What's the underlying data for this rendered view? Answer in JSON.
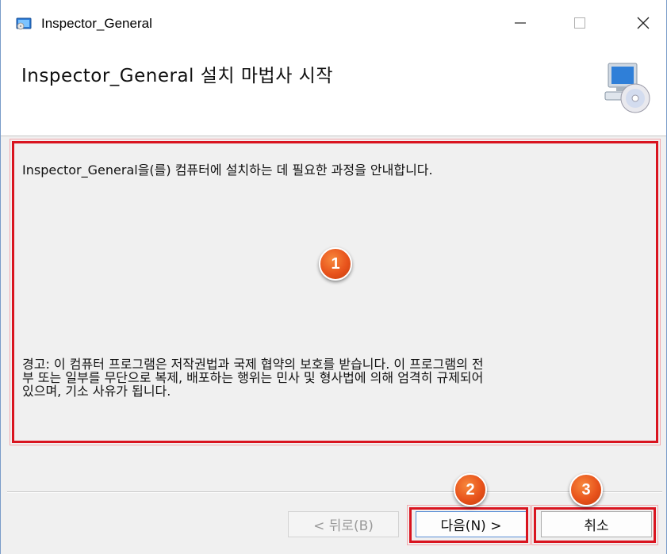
{
  "window": {
    "title": "Inspector_General",
    "app_icon": "installer-icon",
    "controls": {
      "minimize_icon": "minimize-icon",
      "maximize_icon": "maximize-icon",
      "close_icon": "close-icon"
    }
  },
  "header": {
    "title": "Inspector_General 설치 마법사 시작",
    "icon": "computer-cd-icon"
  },
  "content": {
    "intro": "Inspector_General을(를) 컴퓨터에 설치하는 데 필요한 과정을 안내합니다.",
    "warning_lines": [
      "경고: 이 컴퓨터 프로그램은 저작권법과 국제 협약의 보호를 받습니다. 이 프로그램의 전",
      "부 또는 일부를 무단으로 복제, 배포하는 행위는 민사 및 형사법에 의해 엄격히 규제되어",
      "있으며, 기소 사유가 됩니다."
    ]
  },
  "buttons": {
    "back": "< 뒤로(B)",
    "next": "다음(N) >",
    "cancel": "취소"
  },
  "annotations": {
    "badge_1": "1",
    "badge_2": "2",
    "badge_3": "3",
    "highlight_color": "#d9141f",
    "badge_color": "#e8531c"
  }
}
